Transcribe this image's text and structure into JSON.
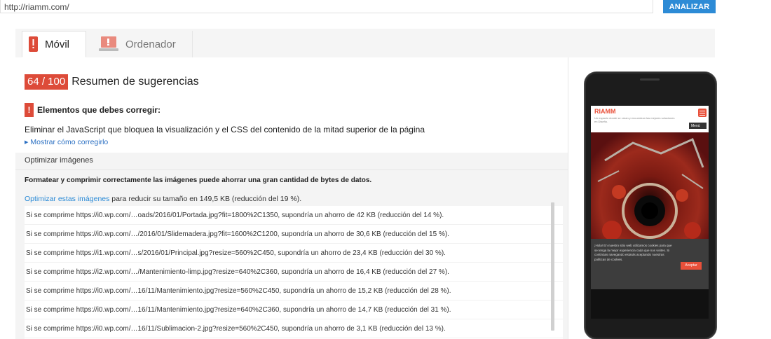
{
  "url_bar": {
    "value": "http://riamm.com/",
    "button_label": "ANALIZAR"
  },
  "tabs": [
    {
      "label": "Móvil",
      "icon": "mobile-icon",
      "active": true
    },
    {
      "label": "Ordenador",
      "icon": "desktop-icon",
      "active": false
    }
  ],
  "summary": {
    "score": "64 / 100",
    "title": "Resumen de sugerencias"
  },
  "fix_section": {
    "title": "Elementos que debes corregir:",
    "rule": "Eliminar el JavaScript que bloquea la visualización y el CSS del contenido de la mitad superior de la página",
    "show_fix": "Mostrar cómo corregirlo"
  },
  "optimize_images": {
    "heading": "Optimizar imágenes",
    "description": "Formatear y comprimir correctamente las imágenes puede ahorrar una gran cantidad de bytes de datos.",
    "link_text": "Optimizar estas imágenes",
    "link_suffix": " para reducir su tamaño en 149,5 KB (reducción del 19 %).",
    "items": [
      "Si se comprime https://i0.wp.com/…oads/2016/01/Portada.jpg?fit=1800%2C1350, supondría un ahorro de 42 KB (reducción del 14 %).",
      "Si se comprime https://i0.wp.com/…/2016/01/Slidemadera.jpg?fit=1600%2C1200, supondría un ahorro de 30,6 KB (reducción del 15 %).",
      "Si se comprime https://i1.wp.com/…s/2016/01/Principal.jpg?resize=560%2C450, supondría un ahorro de 23,4 KB (reducción del 30 %).",
      "Si se comprime https://i2.wp.com/…/Mantenimiento-limp.jpg?resize=640%2C360, supondría un ahorro de 16,4 KB (reducción del 27 %).",
      "Si se comprime https://i0.wp.com/…16/11/Mantenimiento.jpg?resize=560%2C450, supondría un ahorro de 15,2 KB (reducción del 28 %).",
      "Si se comprime https://i0.wp.com/…16/11/Mantenimiento.jpg?resize=640%2C360, supondría un ahorro de 14,7 KB (reducción del 31 %).",
      "Si se comprime https://i0.wp.com/…16/11/Sublimacion-2.jpg?resize=560%2C450, supondría un ahorro de 3,1 KB (reducción del 13 %)."
    ]
  },
  "preview": {
    "site_name": "RIAMM",
    "tagline": "Un espacio donde se crean y encuentran las mejores soluciones en Diseño.",
    "menu_label": "Menú",
    "cookie_text": "¡Hola! En nuestro sitio web utilizamos cookies para que se tenga la mejor experiencia cada que nos visites. Si continúas navegando estarás aceptando nuestras políticas de cookies.",
    "cookie_button": "Aceptar"
  },
  "colors": {
    "accent_blue": "#2d8bd6",
    "score_red": "#dd4b39",
    "link_blue": "#2a6fc2"
  }
}
